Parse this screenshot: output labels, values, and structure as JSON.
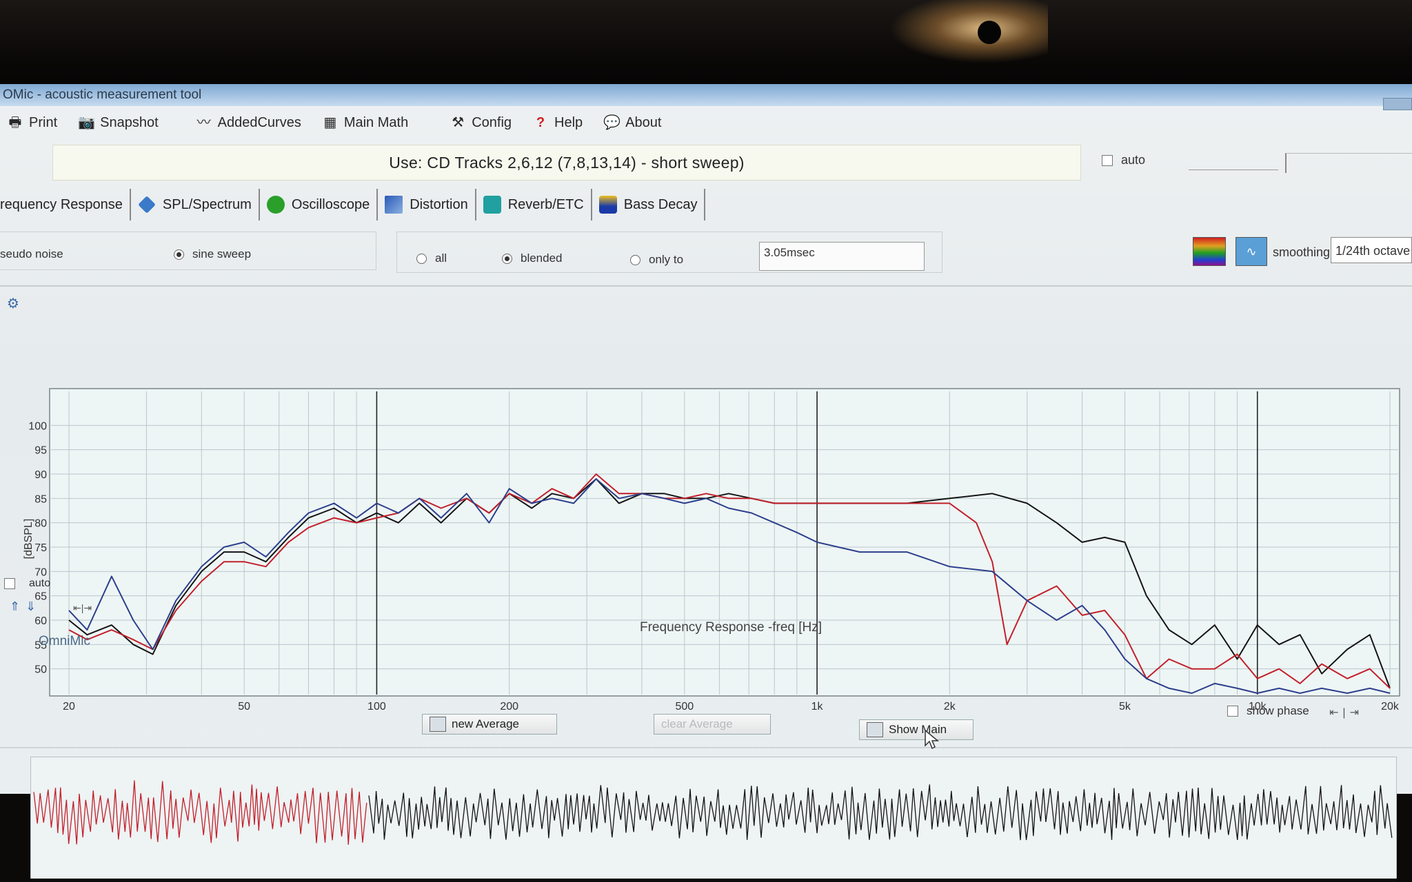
{
  "window": {
    "title": "OMic - acoustic measurement tool"
  },
  "menu": [
    {
      "label": "Print",
      "icon": "printer-icon"
    },
    {
      "label": "Snapshot",
      "icon": "camera-icon"
    },
    {
      "label": "AddedCurves",
      "icon": "curves-icon"
    },
    {
      "label": "Main Math",
      "icon": "calculator-icon"
    },
    {
      "label": "Config",
      "icon": "tools-icon"
    },
    {
      "label": "Help",
      "icon": "question-icon"
    },
    {
      "label": "About",
      "icon": "speech-bubble-icon"
    }
  ],
  "banner": "Use: CD Tracks 2,6,12 (7,8,13,14) - short sweep)",
  "auto_top": "auto",
  "tabs": [
    {
      "label": "requency Response",
      "icon": ""
    },
    {
      "label": "SPL/Spectrum",
      "icon": "tag-icon",
      "color": "#3a7ac8"
    },
    {
      "label": "Oscilloscope",
      "icon": "scope-icon",
      "color": "#2aa02a"
    },
    {
      "label": "Distortion",
      "icon": "distortion-icon",
      "color": "#2a5ab8"
    },
    {
      "label": "Reverb/ETC",
      "icon": "reverb-icon",
      "color": "#20a0a0"
    },
    {
      "label": "Bass Decay",
      "icon": "bass-decay-icon",
      "color": "#1a3aa8"
    }
  ],
  "signal": {
    "pseudo": "seudo noise",
    "sine": "sine sweep",
    "selected": "sine"
  },
  "window_opts": {
    "all": "all",
    "blended": "blended",
    "only_to": "only to",
    "selected": "blended",
    "value": "3.05msec"
  },
  "smoothing": {
    "label": "smoothing",
    "value": "1/24th octave"
  },
  "plot": {
    "ylabel": "[dBSPL]",
    "xlabel": "Frequency Response -freq [Hz]",
    "auto": "auto",
    "show_phase": "show phase"
  },
  "omnimic": "OmniMic",
  "buttons": {
    "new_average": "new Average",
    "clear_average": "clear Average",
    "show_main": "Show Main"
  },
  "colors": {
    "red": "#c2202a",
    "blue": "#2c3f8c",
    "black": "#141414"
  },
  "chart_data": {
    "type": "line",
    "xscale": "log",
    "xlim": [
      20,
      20000
    ],
    "ylim": [
      45,
      105
    ],
    "xticks": [
      {
        "value": 20,
        "label": "20"
      },
      {
        "value": 50,
        "label": "50"
      },
      {
        "value": 100,
        "label": "100"
      },
      {
        "value": 200,
        "label": "200"
      },
      {
        "value": 500,
        "label": "500"
      },
      {
        "value": 1000,
        "label": "1k"
      },
      {
        "value": 2000,
        "label": "2k"
      },
      {
        "value": 5000,
        "label": "5k"
      },
      {
        "value": 10000,
        "label": "10k"
      },
      {
        "value": 20000,
        "label": "20k"
      }
    ],
    "yticks": [
      100,
      95,
      90,
      85,
      80,
      75,
      70,
      65,
      60,
      55,
      50
    ],
    "series": [
      {
        "color": "#141414",
        "x": [
          20,
          22,
          25,
          28,
          31,
          35,
          40,
          45,
          50,
          56,
          63,
          70,
          80,
          90,
          100,
          112,
          125,
          140,
          160,
          180,
          200,
          225,
          250,
          280,
          315,
          355,
          400,
          450,
          500,
          560,
          630,
          710,
          800,
          900,
          1000,
          1250,
          1600,
          2000,
          2500,
          3000,
          3500,
          4000,
          4500,
          5000,
          5600,
          6300,
          7100,
          8000,
          9000,
          10000,
          11200,
          12500,
          14000,
          16000,
          18000,
          20000
        ],
        "y": [
          60,
          57,
          59,
          55,
          53,
          63,
          70,
          74,
          74,
          72,
          77,
          81,
          83,
          80,
          82,
          80,
          84,
          80,
          85,
          82,
          86,
          83,
          86,
          85,
          89,
          84,
          86,
          86,
          85,
          85,
          86,
          85,
          84,
          84,
          84,
          84,
          84,
          85,
          86,
          84,
          80,
          76,
          77,
          76,
          65,
          58,
          55,
          59,
          52,
          59,
          55,
          57,
          49,
          54,
          57,
          46
        ]
      },
      {
        "color": "#c2202a",
        "x": [
          20,
          22,
          25,
          28,
          31,
          35,
          40,
          45,
          50,
          56,
          63,
          70,
          80,
          90,
          100,
          112,
          125,
          140,
          160,
          180,
          200,
          225,
          250,
          280,
          315,
          355,
          400,
          450,
          500,
          560,
          630,
          710,
          800,
          900,
          1000,
          1250,
          1600,
          2000,
          2300,
          2500,
          2700,
          3000,
          3500,
          4000,
          4500,
          5000,
          5600,
          6300,
          7100,
          8000,
          9000,
          10000,
          11200,
          12500,
          14000,
          16000,
          18000,
          20000
        ],
        "y": [
          58,
          56,
          58,
          56,
          54,
          62,
          68,
          72,
          72,
          71,
          76,
          79,
          81,
          80,
          81,
          82,
          85,
          83,
          85,
          82,
          86,
          84,
          87,
          85,
          90,
          86,
          86,
          85,
          85,
          86,
          85,
          85,
          84,
          84,
          84,
          84,
          84,
          84,
          80,
          72,
          55,
          64,
          67,
          61,
          62,
          57,
          48,
          52,
          50,
          50,
          53,
          48,
          50,
          47,
          51,
          48,
          50,
          46
        ]
      },
      {
        "color": "#2c3f8c",
        "x": [
          20,
          22,
          25,
          28,
          31,
          35,
          40,
          45,
          50,
          56,
          63,
          70,
          80,
          90,
          100,
          112,
          125,
          140,
          160,
          180,
          200,
          225,
          250,
          280,
          315,
          355,
          400,
          450,
          500,
          560,
          630,
          710,
          800,
          900,
          1000,
          1250,
          1600,
          2000,
          2500,
          3000,
          3500,
          4000,
          4500,
          5000,
          5600,
          6300,
          7100,
          8000,
          9000,
          10000,
          11200,
          12500,
          14000,
          16000,
          18000,
          20000
        ],
        "y": [
          62,
          58,
          69,
          60,
          54,
          64,
          71,
          75,
          76,
          73,
          78,
          82,
          84,
          81,
          84,
          82,
          85,
          81,
          86,
          80,
          87,
          84,
          85,
          84,
          89,
          85,
          86,
          85,
          84,
          85,
          83,
          82,
          80,
          78,
          76,
          74,
          74,
          71,
          70,
          64,
          60,
          63,
          58,
          52,
          48,
          46,
          45,
          47,
          46,
          45,
          46,
          45,
          46,
          45,
          46,
          45
        ]
      }
    ]
  }
}
